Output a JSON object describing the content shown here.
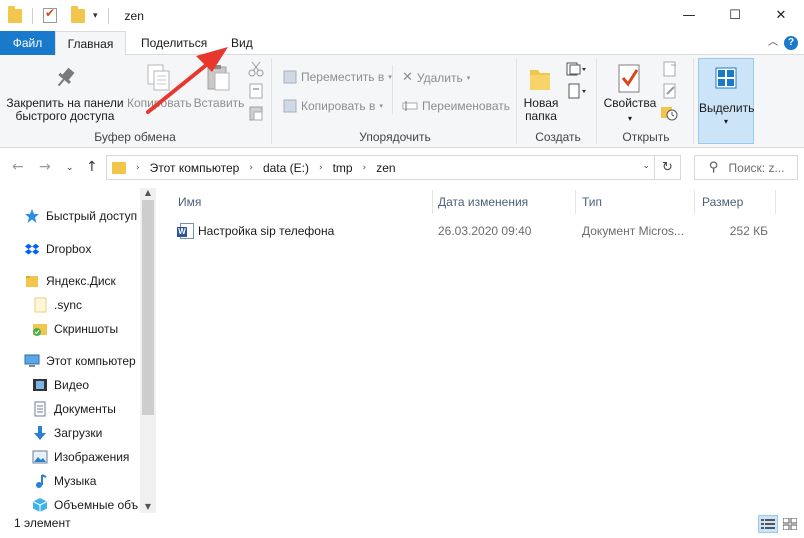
{
  "window": {
    "title": "zen",
    "minimize_glyph": "—",
    "maximize_glyph": "☐",
    "close_glyph": "✕"
  },
  "ribbon_tabs": [
    {
      "label": "Файл"
    },
    {
      "label": "Главная"
    },
    {
      "label": "Поделиться"
    },
    {
      "label": "Вид"
    }
  ],
  "ribbon": {
    "clipboard": {
      "pin_label_1": "Закрепить на панели",
      "pin_label_2": "быстрого доступа",
      "copy_label": "Копировать",
      "paste_label": "Вставить",
      "group_label": "Буфер обмена"
    },
    "organize": {
      "move_label": "Переместить в",
      "copy_to_label": "Копировать в",
      "delete_label": "Удалить",
      "rename_label": "Переименовать",
      "group_label": "Упорядочить"
    },
    "create": {
      "new_folder_1": "Новая",
      "new_folder_2": "папка",
      "group_label": "Создать"
    },
    "open": {
      "properties_label": "Свойства",
      "group_label": "Открыть"
    },
    "select": {
      "select_label": "Выделить"
    }
  },
  "address": {
    "crumbs": [
      "Этот компьютер",
      "data (E:)",
      "tmp",
      "zen"
    ],
    "search_placeholder": "Поиск: z..."
  },
  "sidebar": {
    "items": [
      {
        "label": "Быстрый доступ",
        "icon": "star-icon"
      },
      {
        "label": "Dropbox",
        "icon": "dropbox-icon"
      },
      {
        "label": "Яндекс.Диск",
        "icon": "yandex-disk-icon"
      },
      {
        "label": ".sync",
        "icon": "folder-icon"
      },
      {
        "label": "Скриншоты",
        "icon": "folder-sync-icon"
      },
      {
        "label": "Этот компьютер",
        "icon": "computer-icon"
      },
      {
        "label": "Видео",
        "icon": "video-icon"
      },
      {
        "label": "Документы",
        "icon": "documents-icon"
      },
      {
        "label": "Загрузки",
        "icon": "downloads-icon"
      },
      {
        "label": "Изображения",
        "icon": "pictures-icon"
      },
      {
        "label": "Музыка",
        "icon": "music-icon"
      },
      {
        "label": "Объемные объ",
        "icon": "3d-objects-icon"
      }
    ]
  },
  "file_list": {
    "columns": [
      "Имя",
      "Дата изменения",
      "Тип",
      "Размер"
    ],
    "rows": [
      {
        "name": "Настройка sip телефона",
        "modified": "26.03.2020 09:40",
        "type": "Документ Micros...",
        "size": "252 КБ",
        "icon": "word-document-icon"
      }
    ]
  },
  "status": {
    "item_count": "1 элемент"
  },
  "colors": {
    "file_tab": "#1979ca",
    "ribbon_bg": "#f5f6f7",
    "folder": "#f2c54c",
    "annotation_arrow": "#e8372c",
    "column_header_text": "#4c607a"
  }
}
